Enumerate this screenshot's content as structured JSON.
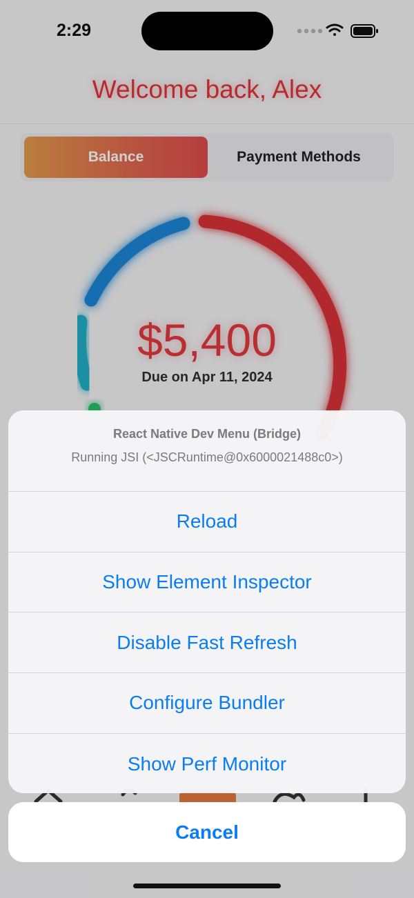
{
  "status": {
    "time": "2:29"
  },
  "header": {
    "welcome": "Welcome back, Alex"
  },
  "tabs": {
    "balance": "Balance",
    "payment_methods": "Payment Methods"
  },
  "balance": {
    "amount": "$5,400",
    "due": "Due on Apr 11, 2024"
  },
  "dev_menu": {
    "title": "React Native Dev Menu (Bridge)",
    "subtitle": "Running JSI (<JSCRuntime@0x6000021488c0>)",
    "actions": [
      "Reload",
      "Show Element Inspector",
      "Disable Fast Refresh",
      "Configure Bundler",
      "Show Perf Monitor"
    ],
    "cancel": "Cancel"
  },
  "colors": {
    "accent_red": "#e0353a",
    "link_blue": "#0a7cf4",
    "ring_blue": "#1f85d6",
    "ring_teal": "#23b0c8",
    "ring_green": "#2bbf6a"
  }
}
